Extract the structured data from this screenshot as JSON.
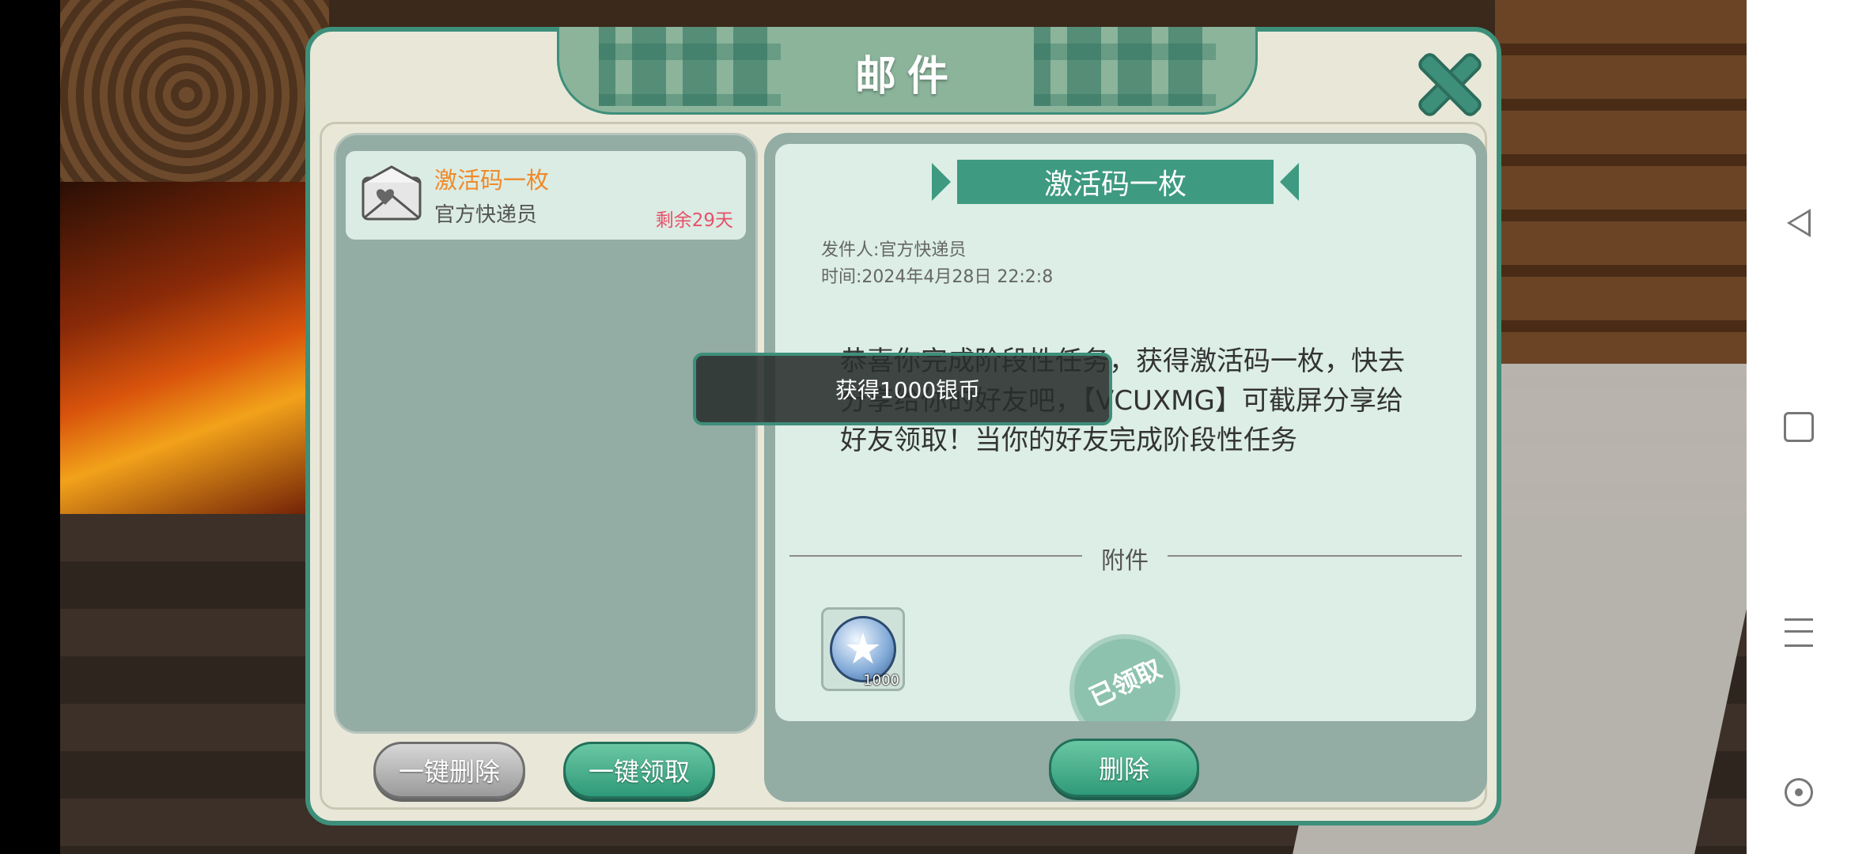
{
  "dialog": {
    "title": "邮件"
  },
  "mail_list": {
    "items": [
      {
        "title": "激活码一枚",
        "sender": "官方快递员",
        "remaining": "剩余29天"
      }
    ],
    "delete_all_label": "一键删除",
    "claim_all_label": "一键领取"
  },
  "mail_detail": {
    "title": "激活码一枚",
    "sender": "发件人:官方快递员",
    "time": "时间:2024年4月28日 22:2:8",
    "body": "恭喜你完成阶段性任务，获得激活码一枚，快去分享给你的好友吧，【VCUXMG】可截屏分享给好友领取！当你的好友完成阶段性任务",
    "attachment_label": "附件",
    "attachment": {
      "icon": "silver-coin-icon",
      "count": "1000"
    },
    "claimed_stamp": "已领取",
    "delete_label": "删除"
  },
  "toast": {
    "text": "获得1000银币"
  },
  "colors": {
    "accent": "#3e8f7a",
    "title_orange": "#ef8a2a",
    "remaining_red": "#e8506a"
  }
}
